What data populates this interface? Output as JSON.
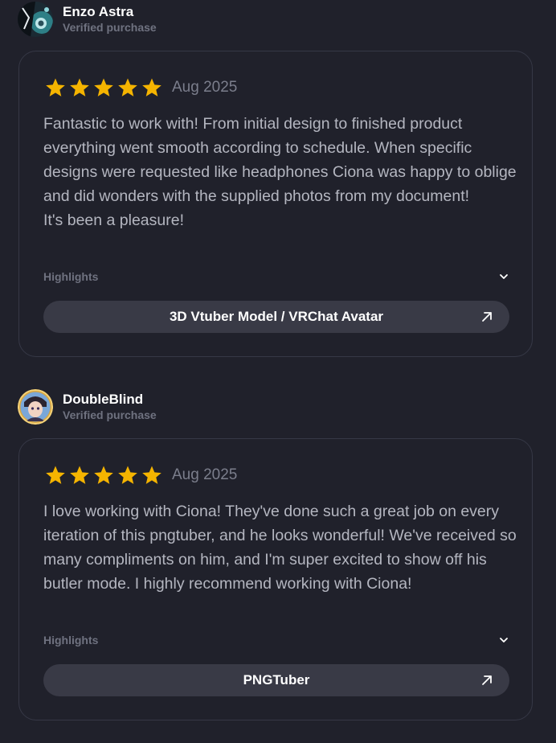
{
  "reviews": [
    {
      "reviewer": {
        "name": "Enzo Astra",
        "badge": "Verified purchase"
      },
      "rating": 5,
      "max_rating": 5,
      "date": "Aug 2025",
      "text": "Fantastic to work with! From initial design to finished product everything went smooth according to schedule. When specific designs were requested like headphones Ciona was happy to oblige and did wonders with the supplied photos from my document!\nIt's been a pleasure!",
      "highlights_label": "Highlights",
      "service": "3D Vtuber Model / VRChat Avatar"
    },
    {
      "reviewer": {
        "name": "DoubleBlind",
        "badge": "Verified purchase"
      },
      "rating": 5,
      "max_rating": 5,
      "date": "Aug 2025",
      "text": "I love working with Ciona! They've done such a great job on every iteration of this pngtuber, and he looks wonderful! We've received so many compliments on him, and I'm super excited to show off his butler mode. I highly recommend working with Ciona!",
      "highlights_label": "Highlights",
      "service": "PNGTuber"
    }
  ],
  "colors": {
    "background": "#20212b",
    "star": "#f5b400",
    "button": "#393a46"
  },
  "icons": {
    "star": "star-icon",
    "chevron": "chevron-down-icon",
    "external": "arrow-up-right-icon"
  }
}
